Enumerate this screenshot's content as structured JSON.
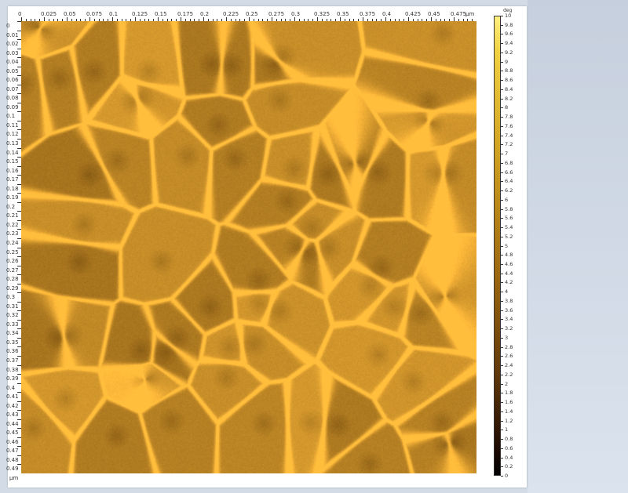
{
  "x_axis": {
    "unit": "µm",
    "labels": [
      "0",
      "0.025",
      "0.05",
      "0.075",
      "0.1",
      "0.125",
      "0.15",
      "0.175",
      "0.2",
      "0.225",
      "0.25",
      "0.275",
      "0.3",
      "0.325",
      "0.35",
      "0.375",
      "0.4",
      "0.425",
      "0.45",
      "0.475"
    ]
  },
  "y_axis": {
    "unit": "µm",
    "labels": [
      "0",
      "0.01",
      "0.02",
      "0.03",
      "0.04",
      "0.05",
      "0.06",
      "0.07",
      "0.08",
      "0.09",
      "0.1",
      "0.11",
      "0.12",
      "0.13",
      "0.14",
      "0.15",
      "0.16",
      "0.17",
      "0.18",
      "0.19",
      "0.2",
      "0.21",
      "0.22",
      "0.23",
      "0.24",
      "0.25",
      "0.26",
      "0.27",
      "0.28",
      "0.29",
      "0.3",
      "0.31",
      "0.32",
      "0.33",
      "0.34",
      "0.35",
      "0.36",
      "0.37",
      "0.38",
      "0.39",
      "0.4",
      "0.41",
      "0.42",
      "0.43",
      "0.44",
      "0.45",
      "0.46",
      "0.47",
      "0.48",
      "0.49"
    ]
  },
  "colorbar": {
    "unit": "deg",
    "min": 0,
    "max": 10,
    "labels": [
      "10",
      "9.8",
      "9.6",
      "9.4",
      "9.2",
      "9",
      "8.8",
      "8.6",
      "8.4",
      "8.2",
      "8",
      "7.8",
      "7.6",
      "7.4",
      "7.2",
      "7",
      "6.8",
      "6.6",
      "6.4",
      "6.2",
      "6",
      "5.8",
      "5.6",
      "5.4",
      "5.2",
      "5",
      "4.8",
      "4.6",
      "4.4",
      "4.2",
      "4",
      "3.8",
      "3.6",
      "3.4",
      "3.2",
      "3",
      "2.8",
      "2.6",
      "2.4",
      "2.2",
      "2",
      "1.8",
      "1.6",
      "1.4",
      "1.2",
      "1",
      "0.8",
      "0.6",
      "0.4",
      "0.2",
      "0"
    ]
  }
}
